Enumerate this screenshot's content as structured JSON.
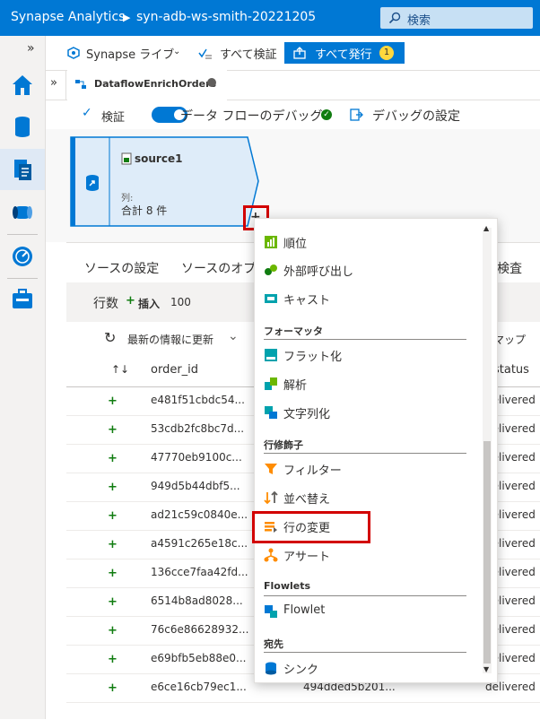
{
  "topbar": {
    "app_title": "Synapse Analytics",
    "separator": "▶",
    "workspace": "syn-adb-ws-smith-20221205",
    "search_placeholder": "検索"
  },
  "toolbar": {
    "synapse_live": "Synapse ライブ",
    "validate_all": "すべて検証",
    "publish_all": "すべて発行",
    "publish_count": "1"
  },
  "tab": {
    "name": "DataflowEnrichOrders"
  },
  "dataflow_toolbar": {
    "validate": "検証",
    "debug": "データ フローのデバッグ",
    "debug_settings": "デバッグの設定"
  },
  "node": {
    "name": "source1",
    "columns_label": "列:",
    "columns_total": "合計 8 件",
    "add_button": "+"
  },
  "panel": {
    "tab_source_settings": "ソースの設定",
    "tab_source_options": "ソースのオプ",
    "tab_inspect": "検査",
    "rows_label": "行数",
    "insert_label": "插入",
    "insert_count": "100",
    "refresh": "最新の情報に更新",
    "map": "マップ",
    "columns": [
      "order_id",
      "status"
    ],
    "rows": [
      {
        "order_id": "e481f51cbdc54...",
        "c2": "",
        "status": "delivered"
      },
      {
        "order_id": "53cdb2fc8bc7d...",
        "c2": "",
        "status": "delivered"
      },
      {
        "order_id": "47770eb9100c...",
        "c2": "",
        "status": "delivered"
      },
      {
        "order_id": "949d5b44dbf5...",
        "c2": "",
        "status": "delivered"
      },
      {
        "order_id": "ad21c59c0840e...",
        "c2": "",
        "status": "delivered"
      },
      {
        "order_id": "a4591c265e18c...",
        "c2": "",
        "status": "delivered"
      },
      {
        "order_id": "136cce7faa42fd...",
        "c2": "",
        "status": "delivered"
      },
      {
        "order_id": "6514b8ad8028...",
        "c2": "",
        "status": "delivered"
      },
      {
        "order_id": "76c6e86628932...",
        "c2": "",
        "status": "delivered"
      },
      {
        "order_id": "e69bfb5eb88e0...",
        "c2": "",
        "status": "delivered"
      },
      {
        "order_id": "e6ce16cb79ec1...",
        "c2": "494dded5b201...",
        "status": "delivered"
      }
    ]
  },
  "menu": {
    "item_rank": "順位",
    "item_external_call": "外部呼び出し",
    "item_cast": "キャスト",
    "header_formatters": "フォーマッタ",
    "item_flatten": "フラット化",
    "item_parse": "解析",
    "item_stringify": "文字列化",
    "header_row_modifiers": "行修飾子",
    "item_filter": "フィルター",
    "item_sort": "並べ替え",
    "item_alter_row": "行の変更",
    "item_assert": "アサート",
    "header_flowlets": "Flowlets",
    "item_flowlet": "Flowlet",
    "header_destination": "宛先",
    "item_sink": "シンク"
  }
}
